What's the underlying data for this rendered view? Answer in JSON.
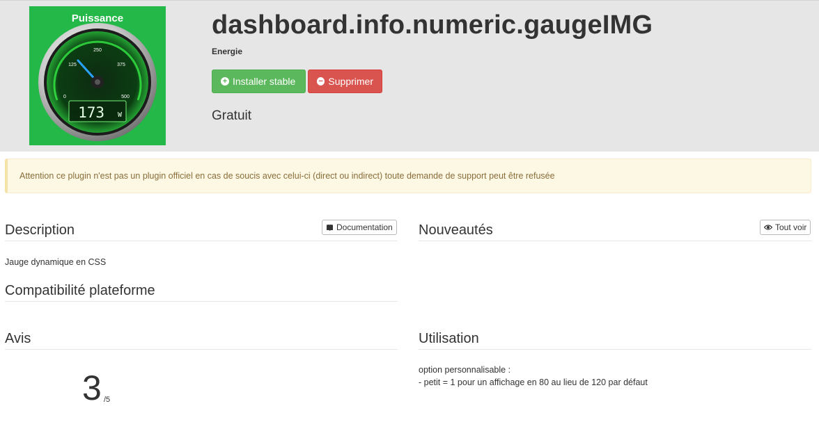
{
  "header": {
    "thumbnail": {
      "caption": "Puissance",
      "ticks": [
        "0",
        "125",
        "250",
        "375",
        "500"
      ],
      "readout_value": "173",
      "readout_unit": "W"
    },
    "title": "dashboard.info.numeric.gaugeIMG",
    "category": "Energie",
    "install_label": "Installer stable",
    "remove_label": "Supprimer",
    "price": "Gratuit"
  },
  "alert": {
    "text": "Attention ce plugin n'est pas un plugin officiel en cas de soucis avec celui-ci (direct ou indirect) toute demande de support peut être refusée"
  },
  "description": {
    "title": "Description",
    "doc_button": "Documentation",
    "text": "Jauge dynamique en CSS"
  },
  "compat": {
    "title": "Compatibilité plateforme"
  },
  "news": {
    "title": "Nouveautés",
    "see_all": "Tout voir"
  },
  "reviews": {
    "title": "Avis",
    "score": "3",
    "max": "/5"
  },
  "usage": {
    "title": "Utilisation",
    "line1": "option personnalisable :",
    "line2": "- petit = 1 pour un affichage en 80 au lieu de 120 par défaut"
  },
  "colors": {
    "thumb_bg": "#23b847",
    "install": "#5cb85c",
    "remove": "#d9534f",
    "alert_bg": "#fcf8e3",
    "alert_text": "#8a6d3b"
  },
  "icons": {
    "install": "plus-circle-icon",
    "remove": "minus-circle-icon",
    "documentation": "book-icon",
    "see_all": "eye-icon"
  }
}
